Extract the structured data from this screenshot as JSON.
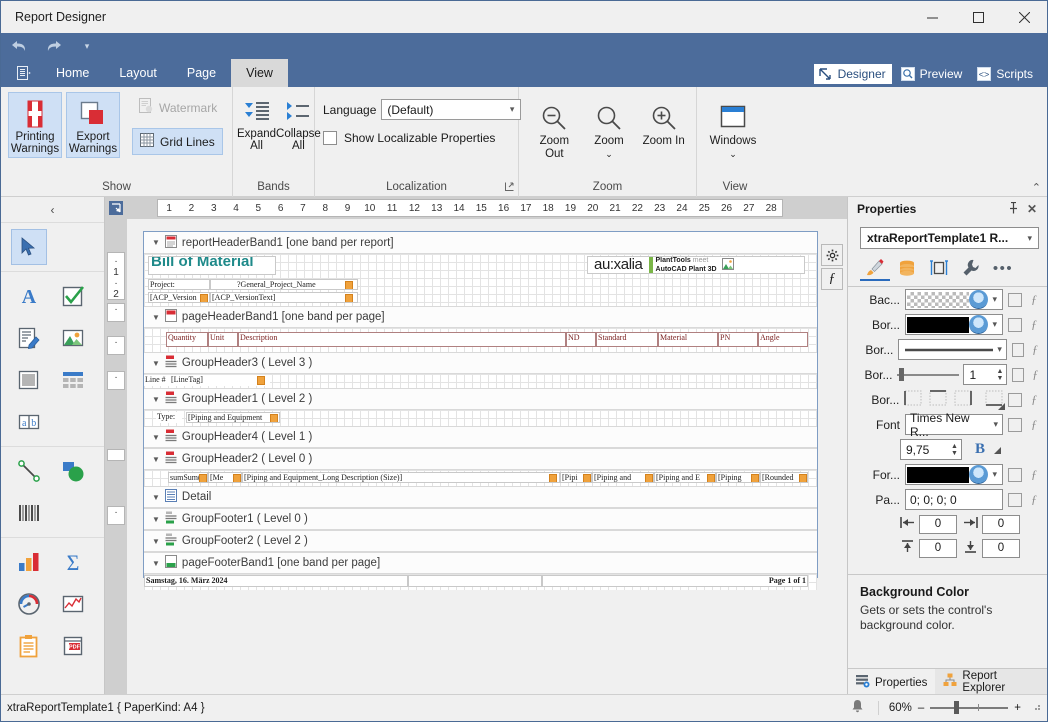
{
  "window": {
    "title": "Report Designer",
    "minimize": "–",
    "maximize": "▢",
    "close": "✕"
  },
  "quick_access": {
    "undo": "undo-arrow",
    "redo": "redo-arrow",
    "more": "▾"
  },
  "ribbon": {
    "tabs": [
      "Home",
      "Layout",
      "Page",
      "View"
    ],
    "active_tab": "View",
    "view_modes": [
      {
        "label": "Designer",
        "icon": "designer-icon",
        "active": true
      },
      {
        "label": "Preview",
        "icon": "preview-icon",
        "active": false
      },
      {
        "label": "Scripts",
        "icon": "scripts-icon",
        "active": false
      }
    ],
    "groups": [
      {
        "title": "Show",
        "buttons": [
          {
            "label": "Printing\nWarnings",
            "line1": "Printing",
            "line2": "Warnings",
            "selected": true
          },
          {
            "label": "Export\nWarnings",
            "line1": "Export",
            "line2": "Warnings",
            "selected": true
          }
        ],
        "small_buttons": [
          {
            "label": "Watermark",
            "disabled": true,
            "selected": false
          },
          {
            "label": "Grid Lines",
            "disabled": false,
            "selected": true
          }
        ]
      },
      {
        "title": "Bands",
        "buttons": [
          {
            "line1": "Expand",
            "line2": "All"
          },
          {
            "line1": "Collapse",
            "line2": "All"
          }
        ]
      },
      {
        "title": "Localization",
        "language_label": "Language",
        "language_value": "(Default)",
        "checkbox_label": "Show Localizable Properties",
        "checkbox_checked": false,
        "has_dialog_launcher": true
      },
      {
        "title": "Zoom",
        "buttons": [
          {
            "line1": "Zoom Out",
            "line2": ""
          },
          {
            "line1": "Zoom",
            "line2": "⌄"
          },
          {
            "line1": "Zoom In",
            "line2": ""
          }
        ]
      },
      {
        "title": "View",
        "buttons": [
          {
            "line1": "Windows",
            "line2": "⌄"
          }
        ]
      }
    ]
  },
  "toolbox": {
    "collapse": "‹",
    "sections": [
      {
        "items": [
          {
            "name": "pointer-tool",
            "selected": true
          }
        ]
      },
      {
        "items": [
          {
            "name": "label-tool",
            "selected": false
          },
          {
            "name": "check-box-tool",
            "selected": false
          },
          {
            "name": "rich-text-tool",
            "selected": false
          },
          {
            "name": "picture-box-tool",
            "selected": false
          },
          {
            "name": "panel-tool",
            "selected": false
          },
          {
            "name": "table-tool",
            "selected": false
          },
          {
            "name": "character-comb-tool",
            "selected": false
          }
        ]
      },
      {
        "items": [
          {
            "name": "line-tool",
            "selected": false
          },
          {
            "name": "shape-tool",
            "selected": false
          },
          {
            "name": "barcode-tool",
            "selected": false
          }
        ]
      },
      {
        "items": [
          {
            "name": "chart-tool",
            "selected": false
          },
          {
            "name": "sparkline-tool",
            "selected": false
          },
          {
            "name": "gauge-tool",
            "selected": false
          },
          {
            "name": "pivot-grid-tool",
            "selected": false
          },
          {
            "name": "subreport-tool",
            "selected": false
          },
          {
            "name": "pdf-content-tool",
            "selected": false
          }
        ]
      }
    ]
  },
  "designer": {
    "ruler_marks": [
      "1",
      "2",
      "3",
      "4",
      "5",
      "6",
      "7",
      "8",
      "9",
      "10",
      "11",
      "12",
      "13",
      "14",
      "15",
      "16",
      "17",
      "18",
      "19",
      "20",
      "21",
      "22",
      "23",
      "24",
      "25",
      "26",
      "27",
      "28"
    ],
    "vruler_marks": [
      "1",
      "2"
    ],
    "side_buttons": [
      {
        "name": "smart-tag-button",
        "glyph": "✲"
      },
      {
        "name": "expression-button",
        "glyph": "ƒ"
      }
    ],
    "bands": [
      {
        "name": "reportHeaderBand1",
        "label": "reportHeaderBand1 [one band per report]",
        "icon": "report-header-icon"
      },
      {
        "name": "pageHeaderBand1",
        "label": "pageHeaderBand1 [one band per page]",
        "icon": "page-header-icon"
      },
      {
        "name": "GroupHeader3",
        "label": "GroupHeader3 ( Level 3 )",
        "icon": "group-header-icon"
      },
      {
        "name": "GroupHeader1",
        "label": "GroupHeader1 ( Level 2 )",
        "icon": "group-header-icon"
      },
      {
        "name": "GroupHeader4",
        "label": "GroupHeader4 ( Level 1 )",
        "icon": "group-header-icon"
      },
      {
        "name": "GroupHeader2",
        "label": "GroupHeader2 ( Level 0 )",
        "icon": "group-header-icon"
      },
      {
        "name": "Detail",
        "label": "Detail",
        "icon": "detail-icon"
      },
      {
        "name": "GroupFooter1",
        "label": "GroupFooter1 ( Level 0 )",
        "icon": "group-footer-icon"
      },
      {
        "name": "GroupFooter2",
        "label": "GroupFooter2 ( Level 2 )",
        "icon": "group-footer-icon"
      },
      {
        "name": "pageFooterBand1",
        "label": "pageFooterBand1 [one band per page]",
        "icon": "page-footer-icon"
      }
    ],
    "report_header": {
      "title": "Bill of Material",
      "logo_text": "au:xalia",
      "logo_sub_line1": "PlantTools",
      "logo_sub_line1b": "meet",
      "logo_sub_line2": "AutoCAD Plant 3D",
      "project_label": "Project:",
      "project_value": "?General_Project_Name",
      "acp_version_label": "[ACP_Version",
      "acp_version_text": "[ACP_VersionText]"
    },
    "page_header_columns": [
      "Quantity",
      "Unit",
      "Description",
      "ND",
      "Standard",
      "Material",
      "PN",
      "Angle"
    ],
    "group_header3": {
      "label": "Line #",
      "field": "[LineTag]"
    },
    "group_header1": {
      "label": "Type:",
      "field": "[Piping and Equipment"
    },
    "group_header2_fields": [
      "sumSum(",
      "[Me",
      "[Piping and Equipment_Long Description (Size)]",
      "[Pipi",
      "[Piping and ",
      "[Piping and E",
      "[Piping ",
      "[Rounded"
    ],
    "page_footer": {
      "date": "Samstag, 16. März 2024",
      "page": "Page 1 of 1"
    }
  },
  "properties": {
    "title": "Properties",
    "pin": "pin-icon",
    "close": "✕",
    "object": "xtraReportTemplate1  R...",
    "category_tabs": [
      {
        "name": "appearance-tab",
        "icon": "brush-icon",
        "selected": true
      },
      {
        "name": "data-tab",
        "icon": "database-icon",
        "selected": false
      },
      {
        "name": "layout-tab",
        "icon": "layout-icon",
        "selected": false
      },
      {
        "name": "behavior-tab",
        "icon": "wrench-icon",
        "selected": false
      },
      {
        "name": "misc-tab",
        "icon": "ellipsis-icon",
        "selected": false
      }
    ],
    "rows": [
      {
        "label": "Bac...",
        "type": "color",
        "value": "",
        "color": "transparent"
      },
      {
        "label": "Bor...",
        "type": "color",
        "value": "",
        "color": "#000000"
      },
      {
        "label": "Bor...",
        "type": "linestyle",
        "value": ""
      },
      {
        "label": "Bor...",
        "type": "slider",
        "value": "1"
      },
      {
        "label": "Bor...",
        "type": "borderside",
        "value": ""
      },
      {
        "label": "Font",
        "type": "combo",
        "value": "Times New R..."
      },
      {
        "label": "",
        "type": "fontsize",
        "value": "9,75",
        "bold": "B"
      },
      {
        "label": "For...",
        "type": "color",
        "value": "",
        "color": "#000000"
      },
      {
        "label": "Pa...",
        "type": "text",
        "value": "0; 0; 0; 0"
      }
    ],
    "padding": {
      "left": "0",
      "right": "0",
      "top": "0",
      "bottom": "0"
    },
    "description": {
      "title": "Background Color",
      "text": "Gets or sets the control's background color."
    },
    "bottom_tabs": [
      {
        "label": "Properties",
        "selected": true,
        "icon": "properties-icon"
      },
      {
        "label": "Report Explorer",
        "selected": false,
        "icon": "report-explorer-icon"
      }
    ]
  },
  "statusbar": {
    "text": "xtraReportTemplate1 { PaperKind: A4 }",
    "notification": "bell-icon",
    "zoom": "60%",
    "zoom_out": "–",
    "zoom_in": "+"
  }
}
